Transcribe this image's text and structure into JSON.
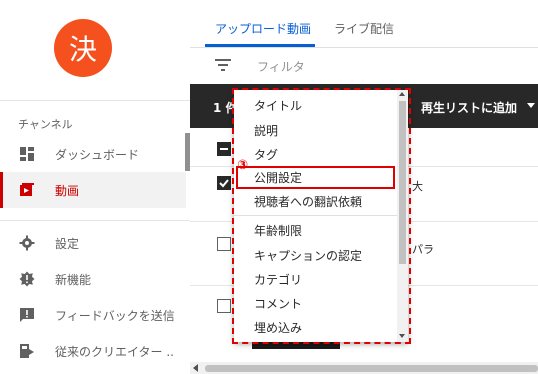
{
  "colors": {
    "avatar": "#f4511e",
    "accent_blue": "#065fd4",
    "active_red": "#cc0000",
    "annotation_red": "#e00000"
  },
  "sidebar": {
    "avatar_char": "決",
    "channel_label": "チャンネル",
    "items": [
      {
        "label": "ダッシュボード",
        "icon": "dashboard-icon"
      },
      {
        "label": "動画",
        "icon": "video-icon"
      },
      {
        "label": "設定",
        "icon": "gear-icon"
      },
      {
        "label": "新機能",
        "icon": "whats-new-icon"
      },
      {
        "label": "フィードバックを送信",
        "icon": "feedback-icon"
      },
      {
        "label": "従来のクリエイター ..",
        "icon": "classic-studio-icon"
      }
    ]
  },
  "main": {
    "tabs": [
      {
        "label": "アップロード動画"
      },
      {
        "label": "ライブ配信"
      }
    ],
    "filter_placeholder": "フィルタ",
    "action_bar": {
      "selected_count": "1 件",
      "add_to_playlist": "再生リストに追加"
    },
    "rows": [
      {
        "visible_text": "大"
      },
      {
        "visible_text": "パラ"
      }
    ]
  },
  "dropdown": {
    "items": [
      "タイトル",
      "説明",
      "タグ",
      "公開設定",
      "視聴者への翻訳依頼",
      "年齢制限",
      "キャプションの認定",
      "カテゴリ",
      "コメント",
      "埋め込み"
    ]
  },
  "annotation": {
    "step": "③"
  }
}
